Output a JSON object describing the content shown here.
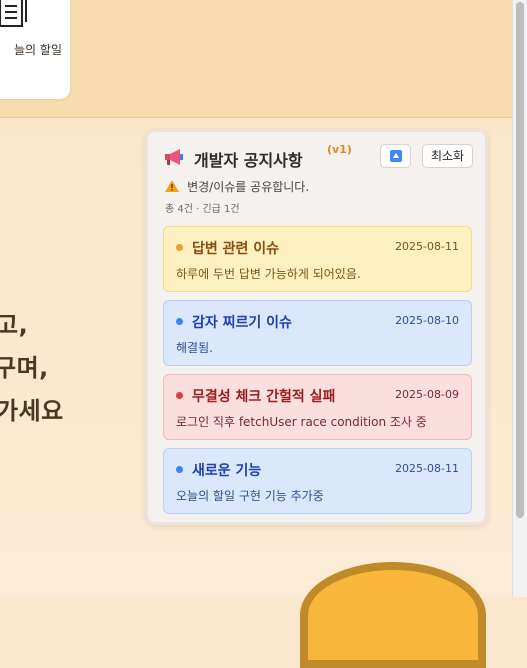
{
  "background": {
    "task_card": {
      "label": "늘의 할일"
    },
    "hero_lines": [
      "고,",
      "구며,",
      "가세요"
    ]
  },
  "panel": {
    "title": "개발자 공지사항",
    "version": "(v1)",
    "up_button_icon": "up-arrow-icon",
    "minimize_label": "최소화",
    "subtitle": "변경/이슈를 공유합니다.",
    "summary": "총 4건 · 긴급 1건",
    "notices": [
      {
        "title": "답변 관련 이슈",
        "date": "2025-08-11",
        "body": "하루에 두번 답변 가능하게 되어있음.",
        "bg": "#fdf1c1",
        "border": "#f3dc8a",
        "accent": "#f0a020",
        "title_color": "#8a4b0c",
        "text_color": "#7a5416"
      },
      {
        "title": "감자 찌르기 이슈",
        "date": "2025-08-10",
        "body": "해결됨.",
        "bg": "#dbe8fc",
        "border": "#b9d1f5",
        "accent": "#3b82f6",
        "title_color": "#1e40af",
        "text_color": "#2f4f8a"
      },
      {
        "title": "무결성 체크 간헐적 실패",
        "date": "2025-08-09",
        "body": "로그인 직후 fetchUser race condition 조사 중",
        "bg": "#fbdede",
        "border": "#f3b9b9",
        "accent": "#e23b3b",
        "title_color": "#9b1c1c",
        "text_color": "#7a2a2a"
      },
      {
        "title": "새로운 기능",
        "date": "2025-08-11",
        "body": "오늘의 할일 구현 기능 추가중",
        "bg": "#dbe8fc",
        "border": "#b9d1f5",
        "accent": "#3b82f6",
        "title_color": "#1e40af",
        "text_color": "#2f4f8a"
      }
    ]
  }
}
